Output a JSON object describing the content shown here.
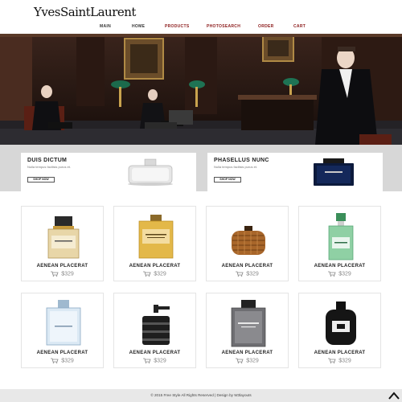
{
  "brand": {
    "logo_text": "YvesSaintLaurent"
  },
  "nav": {
    "items": [
      {
        "label": "MAIN",
        "color": "#333333"
      },
      {
        "label": "HOME",
        "color": "#333333"
      },
      {
        "label": "PRODUCTS",
        "color": "#8b1a1a"
      },
      {
        "label": "PHOTOSEARCH",
        "color": "#8b1a1a"
      },
      {
        "label": "ORDER",
        "color": "#8b1a1a"
      },
      {
        "label": "CART",
        "color": "#8b1a1a"
      }
    ]
  },
  "promos": [
    {
      "title": "DUIS DICTUM",
      "subtitle": "Nulla tempus facilisis purus et.",
      "button": "SHOP NOW",
      "image_icon": "silver-perfume-bottle"
    },
    {
      "title": "PHASELLUS NUNC",
      "subtitle": "Nulla tempus facilisis purus et.",
      "button": "SHOP NOW",
      "image_icon": "dark-blue-perfume-bottle"
    }
  ],
  "products": [
    {
      "name": "AENEAN PLACERAT",
      "price": "$329",
      "image_icon": "gold-cap-bottle"
    },
    {
      "name": "AENEAN PLACERAT",
      "price": "$329",
      "image_icon": "burberry-bottle"
    },
    {
      "name": "AENEAN PLACERAT",
      "price": "$329",
      "image_icon": "wicker-bottle"
    },
    {
      "name": "AENEAN PLACERAT",
      "price": "$329",
      "image_icon": "green-bottle"
    },
    {
      "name": "AENEAN PLACERAT",
      "price": "$329",
      "image_icon": "clear-blue-bottle"
    },
    {
      "name": "AENEAN PLACERAT",
      "price": "$329",
      "image_icon": "black-cylinder-bottle"
    },
    {
      "name": "AENEAN PLACERAT",
      "price": "$329",
      "image_icon": "allure-homme-bottle"
    },
    {
      "name": "AENEAN PLACERAT",
      "price": "$329",
      "image_icon": "ck-black-bottle"
    }
  ],
  "footer": {
    "text": "© 2015 Free Style All Rights Reserved | Design by W3layouts"
  },
  "colors": {
    "accent": "#8b1a1a",
    "band": "#d7d7d7",
    "footer_bg": "#e8e8e8"
  }
}
